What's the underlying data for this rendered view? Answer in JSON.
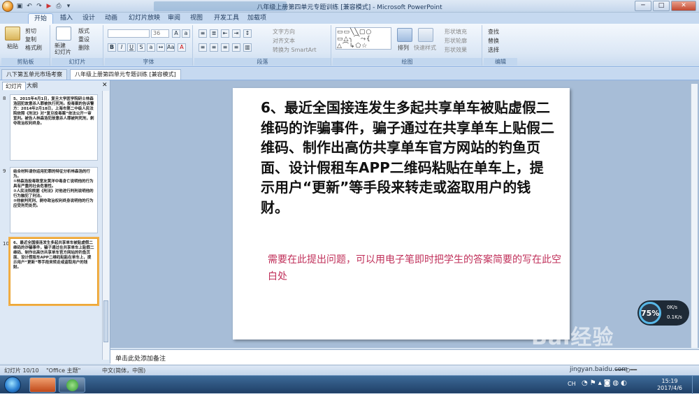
{
  "window": {
    "title": "八年级上册第四单元专题训练 [兼容模式] - Microsoft PowerPoint",
    "controls": {
      "minimize": "─",
      "maximize": "□",
      "close": "✕"
    }
  },
  "ribbon_tabs": [
    "开始",
    "插入",
    "设计",
    "动画",
    "幻灯片放映",
    "审阅",
    "视图",
    "开发工具",
    "加载项"
  ],
  "ribbon": {
    "clipboard": {
      "label": "剪贴板",
      "paste": "粘贴",
      "cut": "剪切",
      "copy": "复制",
      "format_painter": "格式刷"
    },
    "slides": {
      "label": "幻灯片",
      "new_slide": "新建\n幻灯片",
      "layout": "版式",
      "reset": "重设",
      "delete": "删除"
    },
    "font": {
      "label": "字体",
      "font_size": "36"
    },
    "paragraph": {
      "label": "段落",
      "text_direction": "文字方向",
      "align_text": "对齐文本",
      "smartart": "转换为 SmartArt"
    },
    "drawing": {
      "label": "绘图",
      "arrange": "排列",
      "quick_styles": "快速样式",
      "shape_fill": "形状填充",
      "shape_outline": "形状轮廓",
      "shape_effects": "形状效果"
    },
    "editing": {
      "label": "编辑",
      "find": "查找",
      "replace": "替换",
      "select": "选择"
    }
  },
  "doc_tabs": [
    "八下第五单元市场考察",
    "八年级上册第四单元专题训练 [兼容模式]"
  ],
  "left_pane": {
    "tabs": [
      "幻灯片",
      "大纲"
    ],
    "thumbnails": [
      {
        "num": "8",
        "text": "5、2015年4月1日，复旦大学医学院研士林森浩因犯故意杀人罪被执行死刑。投毒案的告诉警方：2014年2月18日，上海市第二中级人民法院依照《刑法》对“复旦投毒案”依法公开一审宣判。被告人林森浩犯故意杀人罪被判死刑，剥夺政治权利终身。"
      },
      {
        "num": "9",
        "text": "结合材料请你运用犯罪的特征分析林森浩的行为。\n①林森浩投毒致室友黄洋中毒身亡说明他的行为具有严重的社会危害性。\n②人民法院根据《刑法》对他进行判刑说明他的行为触犯了刑法。\n③他被判死刑、剥夺政治权利终身说明他的行为应受刑罚处罚。"
      },
      {
        "num": "10",
        "text": "6、最近全国接连发生多起共享单车被贴虚假二维码的诈骗事件，骗子通过在共享单车上贴假二维码、制作出高仿共享单车官方网站的钓鱼页面、设计假租车APP二维码粘贴在单车上，提示用户“更新”等手段来转走或盗取用户的钱财。"
      }
    ]
  },
  "slide": {
    "main_text": "6、最近全国接连发生多起共享单车被贴虚假二维码的诈骗事件，骗子通过在共享单车上贴假二维码、制作出高仿共享单车官方网站的钓鱼页面、设计假租车APP二维码粘贴在单车上，提示用户“更新”等手段来转走或盗取用户的钱财。",
    "note_text": "需要在此提出问题，可以用电子笔即时把学生的答案简要的写在此空白处"
  },
  "notes_placeholder": "单击此处添加备注",
  "status": {
    "slide_info": "幻灯片 10/10",
    "theme": "\"Office 主题\"",
    "language": "中文(简体，中国)"
  },
  "speed_widget": {
    "percent": "75%",
    "up": "0K/s",
    "down": "0.1K/s"
  },
  "watermark": {
    "brand": "Bai经验",
    "url": "jingyan.baidu.com"
  },
  "taskbar": {
    "time": "15:19",
    "date": "2017/4/6",
    "lang": "CH"
  }
}
